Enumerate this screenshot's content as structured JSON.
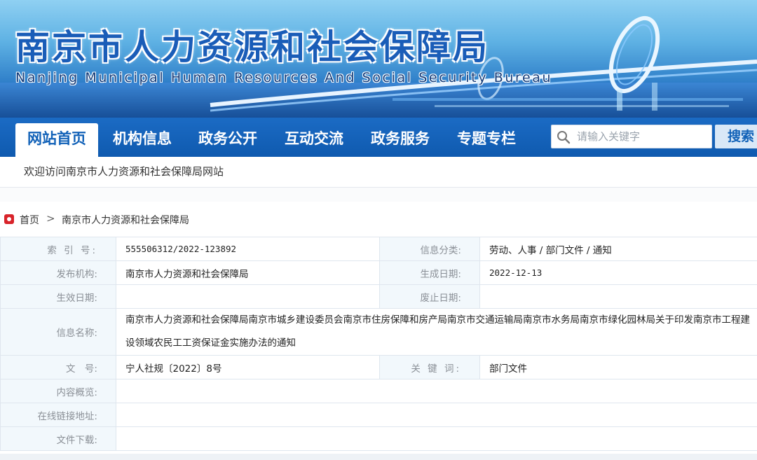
{
  "header": {
    "title_cn": "南京市人力资源和社会保障局",
    "title_en": "Nanjing Municipal Human Resources And Social Security Bureau"
  },
  "nav": {
    "items": [
      {
        "label": "网站首页",
        "active": true
      },
      {
        "label": "机构信息",
        "active": false
      },
      {
        "label": "政务公开",
        "active": false
      },
      {
        "label": "互动交流",
        "active": false
      },
      {
        "label": "政务服务",
        "active": false
      },
      {
        "label": "专题专栏",
        "active": false
      }
    ],
    "search_placeholder": "请输入关键字",
    "search_button": "搜索"
  },
  "welcome": "欢迎访问南京市人力资源和社会保障局网站",
  "breadcrumb": {
    "home": "首页",
    "separator": ">",
    "current": "南京市人力资源和社会保障局"
  },
  "info": {
    "index_label": "索 引 号:",
    "index_value": "555506312/2022-123892",
    "category_label": "信息分类:",
    "category_value": "劳动、人事 / 部门文件 / 通知",
    "publisher_label": "发布机构:",
    "publisher_value": "南京市人力资源和社会保障局",
    "created_label": "生成日期:",
    "created_value": "2022-12-13",
    "effective_label": "生效日期:",
    "effective_value": "",
    "repeal_label": "废止日期:",
    "repeal_value": "",
    "name_label": "信息名称:",
    "name_value": "南京市人力资源和社会保障局南京市城乡建设委员会南京市住房保障和房产局南京市交通运输局南京市水务局南京市绿化园林局关于印发南京市工程建设领域农民工工资保证金实施办法的通知",
    "docno_label": "文　号:",
    "docno_value": "宁人社规〔2022〕8号",
    "keywords_label": "关 键 词:",
    "keywords_value": "部门文件",
    "summary_label": "内容概览:",
    "summary_value": "",
    "link_label": "在线链接地址:",
    "link_value": "",
    "download_label": "文件下载:",
    "download_value": ""
  },
  "colors": {
    "nav_blue": "#0f5aaf",
    "label_bg": "#f2f8fc",
    "brand_blue": "#1262b8"
  }
}
